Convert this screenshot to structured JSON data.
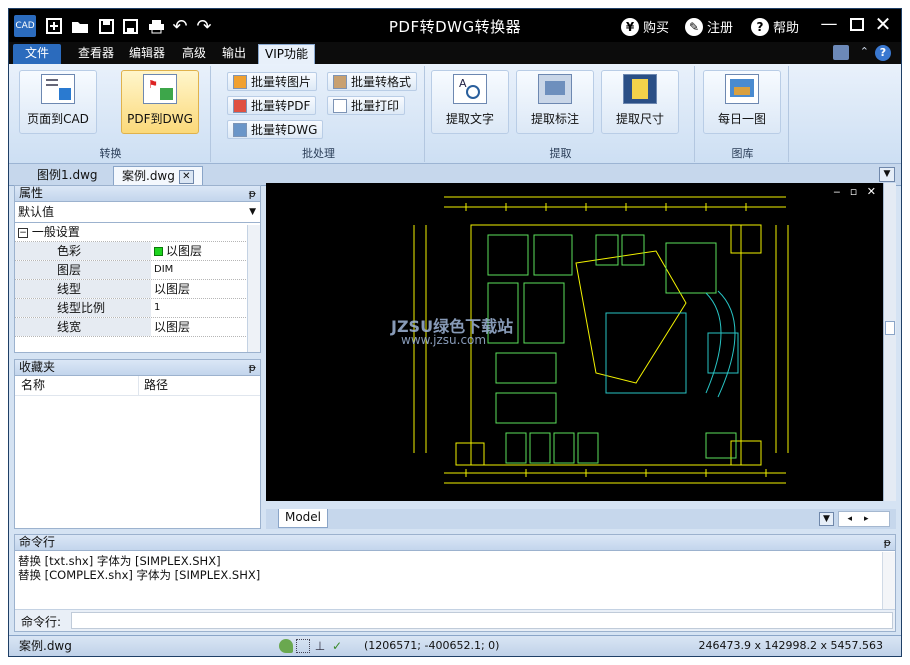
{
  "app": {
    "title": "PDF转DWG转换器"
  },
  "titlebar": {
    "buy": "购买",
    "register": "注册",
    "help": "帮助"
  },
  "menu": {
    "file": "文件",
    "viewer": "查看器",
    "editor": "编辑器",
    "advanced": "高级",
    "output": "输出",
    "vip": "VIP功能"
  },
  "ribbon": {
    "page_to_cad": "页面到CAD",
    "pdf_to_dwg": "PDF到DWG",
    "group_convert": "转换",
    "batch_image": "批量转图片",
    "batch_format": "批量转格式",
    "batch_pdf": "批量转PDF",
    "batch_print": "批量打印",
    "batch_dwg": "批量转DWG",
    "group_batch": "批处理",
    "extract_text": "提取文字",
    "extract_label": "提取标注",
    "extract_dim": "提取尺寸",
    "group_extract": "提取",
    "daily_image": "每日一图",
    "group_library": "图库"
  },
  "tabs": {
    "tab1": "图例1.dwg",
    "tab2": "案例.dwg"
  },
  "properties": {
    "title": "属性",
    "selector": "默认值",
    "section": "一般设置",
    "rows": [
      {
        "key": "色彩",
        "value": "以图层"
      },
      {
        "key": "图层",
        "value": "DIM"
      },
      {
        "key": "线型",
        "value": "以图层"
      },
      {
        "key": "线型比例",
        "value": "1"
      },
      {
        "key": "线宽",
        "value": "以图层"
      }
    ]
  },
  "favorites": {
    "title": "收藏夹",
    "col_name": "名称",
    "col_path": "路径"
  },
  "drawing": {
    "model_tab": "Model",
    "watermark_top": "JZSU绿色下载站",
    "watermark_bottom": "www.jzsu.com"
  },
  "command": {
    "title": "命令行",
    "lines": [
      "替换 [txt.shx] 字体为 [SIMPLEX.SHX]",
      "替换 [COMPLEX.shx] 字体为 [SIMPLEX.SHX]"
    ],
    "prompt_label": "命令行:"
  },
  "status": {
    "file": "案例.dwg",
    "coords": "(1206571; -400652.1; 0)",
    "size": "246473.9 x 142998.2 x 5457.563"
  },
  "colors": {
    "accent": "#2b6bbd",
    "cad_yellow": "#f2f200",
    "cad_green": "#5be05b",
    "cad_cyan": "#28c4c4"
  }
}
